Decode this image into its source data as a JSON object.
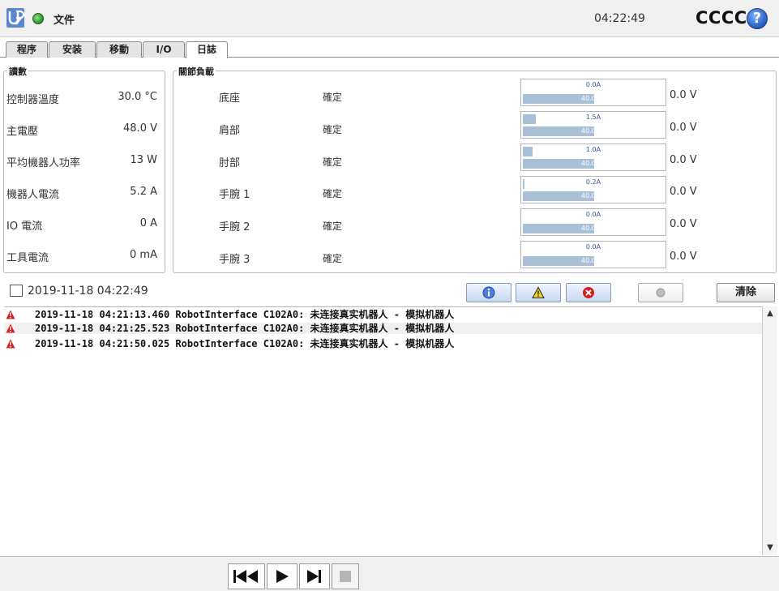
{
  "header": {
    "file_label": "文件",
    "clock": "04:22:49",
    "robot_name": "CCCC",
    "help_symbol": "?"
  },
  "tabs": [
    {
      "label": "程序"
    },
    {
      "label": "安装"
    },
    {
      "label": "移動"
    },
    {
      "label": "I/O"
    },
    {
      "label": "日誌",
      "active": true
    }
  ],
  "readings": {
    "title": "讀數",
    "rows": [
      {
        "label": "控制器溫度",
        "value": "30.0 °C"
      },
      {
        "label": "主電壓",
        "value": "48.0  V"
      },
      {
        "label": "平均機器人功率",
        "value": "13  W"
      },
      {
        "label": "機器人電流",
        "value": "5.2  A"
      },
      {
        "label": "IO 電流",
        "value": "0  A"
      },
      {
        "label": "工具電流",
        "value": "0 mA"
      }
    ]
  },
  "joints": {
    "title": "關節負載",
    "rows": [
      {
        "name": "底座",
        "status": "確定",
        "current": "0.0A",
        "current_fraction": 0.0,
        "temperature": "40.0 °C",
        "voltage": "0.0 V"
      },
      {
        "name": "肩部",
        "status": "確定",
        "current": "1.5A",
        "current_fraction": 0.09,
        "temperature": "40.0 °C",
        "voltage": "0.0 V"
      },
      {
        "name": "肘部",
        "status": "確定",
        "current": "1.0A",
        "current_fraction": 0.07,
        "temperature": "40.0 °C",
        "voltage": "0.0 V"
      },
      {
        "name": "手腕 1",
        "status": "確定",
        "current": "0.2A",
        "current_fraction": 0.01,
        "temperature": "40.0 °C",
        "voltage": "0.0 V"
      },
      {
        "name": "手腕 2",
        "status": "確定",
        "current": "0.0A",
        "current_fraction": 0.0,
        "temperature": "40.0 °C",
        "voltage": "0.0 V"
      },
      {
        "name": "手腕 3",
        "status": "確定",
        "current": "0.0A",
        "current_fraction": 0.0,
        "temperature": "40.0 °C",
        "voltage": "0.0 V"
      }
    ]
  },
  "log": {
    "timestamp": "2019-11-18 04:22:49",
    "clear_label": "清除",
    "filters": [
      {
        "name": "info",
        "icon": "info-icon"
      },
      {
        "name": "warning",
        "icon": "warning-icon"
      },
      {
        "name": "error",
        "icon": "error-icon"
      },
      {
        "name": "debug",
        "icon": "grey-dot-icon"
      }
    ],
    "entries": [
      {
        "level": "warning",
        "text": "2019-11-18 04:21:13.460 RobotInterface C102A0: 未连接真实机器人 - 模拟机器人"
      },
      {
        "level": "warning",
        "text": "2019-11-18 04:21:25.523 RobotInterface C102A0: 未连接真实机器人 - 模拟机器人"
      },
      {
        "level": "warning",
        "text": "2019-11-18 04:21:50.025 RobotInterface C102A0: 未连接真实机器人 - 模拟机器人"
      }
    ]
  },
  "colors": {
    "accent": "#2b5fc4",
    "meter_fill": "#a9c0d9",
    "warning": "#d42020"
  }
}
